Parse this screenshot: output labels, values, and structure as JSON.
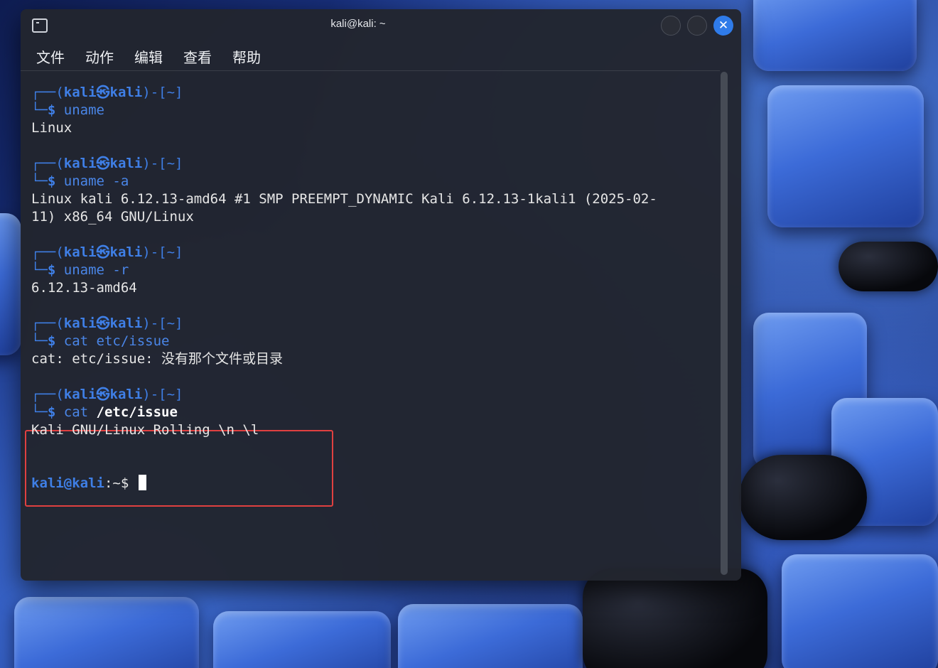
{
  "window": {
    "title": "kali@kali: ~",
    "close_glyph": "✕",
    "icon": "terminal-icon"
  },
  "menu": [
    "文件",
    "动作",
    "编辑",
    "查看",
    "帮助"
  ],
  "prompt": {
    "open": "┌──(",
    "user": "kali㉿kali",
    "close": ")-[~]",
    "dollar_prefix": "└─$ "
  },
  "blocks": [
    {
      "command": "uname",
      "output": [
        "Linux"
      ]
    },
    {
      "command": "uname -a",
      "output": [
        "Linux kali 6.12.13-amd64 #1 SMP PREEMPT_DYNAMIC Kali 6.12.13-1kali1 (2025-02-",
        "11) x86_64 GNU/Linux"
      ]
    },
    {
      "command": "uname -r",
      "output": [
        "6.12.13-amd64"
      ]
    },
    {
      "command": "cat etc/issue",
      "output": [
        "cat: etc/issue: 没有那个文件或目录"
      ]
    },
    {
      "command_plain": "cat ",
      "command_bold": "/etc/issue",
      "output": [
        "Kali GNU/Linux Rolling \\n \\l"
      ]
    }
  ],
  "final_prompt": {
    "user": "kali@kali",
    "path": ":~$ "
  },
  "colors": {
    "accent": "#3f7fe6",
    "highlight_box": "#e04040",
    "terminal_bg": "#22252e"
  }
}
